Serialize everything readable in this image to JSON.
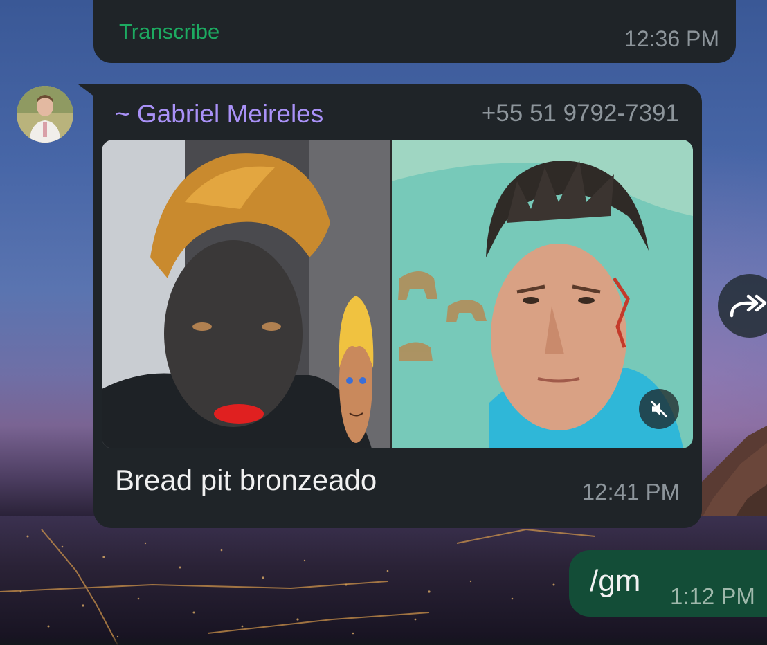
{
  "previous_message": {
    "transcribe_label": "Transcribe",
    "time": "12:36 PM"
  },
  "message": {
    "sender_name": "~ Gabriel Meireles",
    "sender_phone": "+55 51 9792-7391",
    "caption": "Bread pit bronzeado",
    "time": "12:41 PM",
    "media_type": "video",
    "media_icon": "muted-speaker-icon"
  },
  "outgoing_message": {
    "text": "/gm",
    "time": "1:12 PM"
  },
  "icons": {
    "forward": "forward-icon",
    "avatar": "contact-avatar"
  },
  "colors": {
    "bubble_incoming": "#1f2428",
    "bubble_outgoing": "#134d37",
    "sender_name": "#a991f7",
    "transcribe": "#1daa61",
    "timestamp": "#8d959b"
  }
}
